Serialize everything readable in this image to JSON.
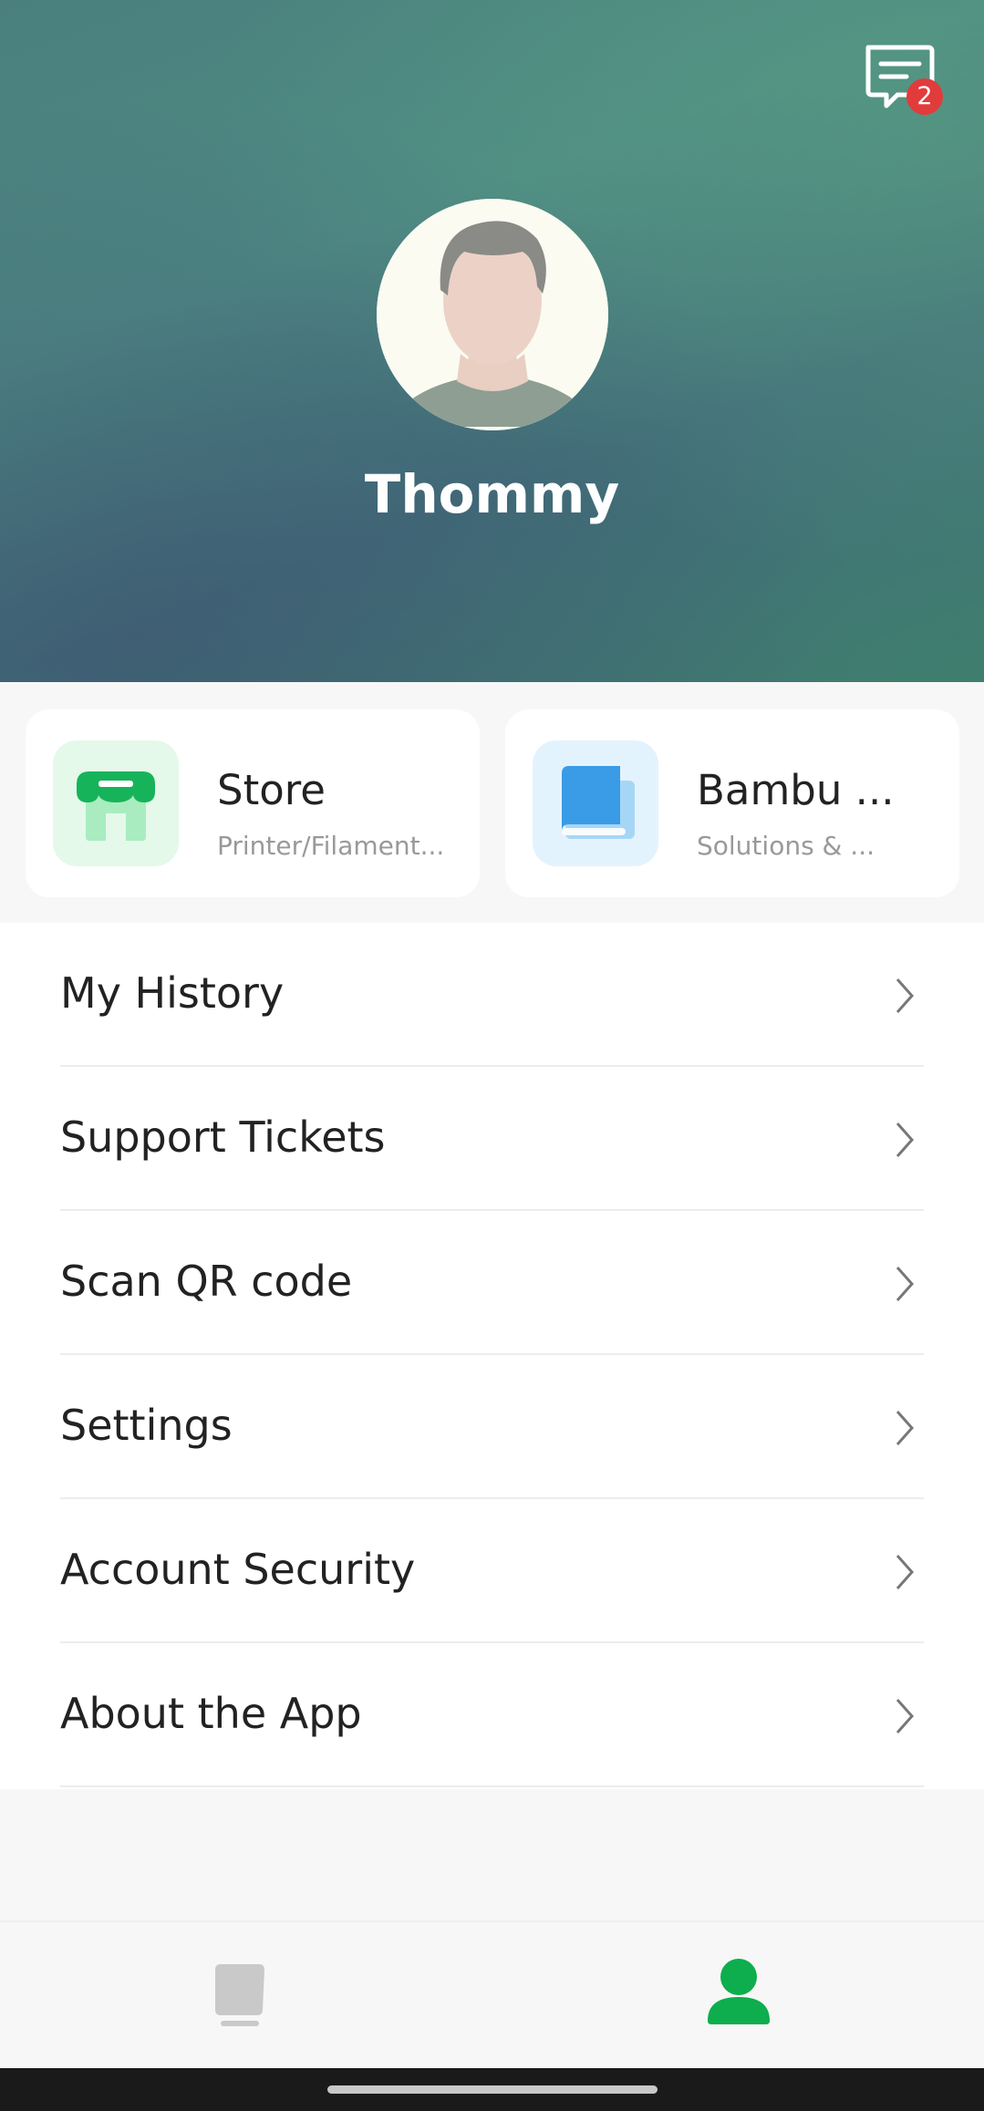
{
  "header": {
    "message_badge_count": "2",
    "username": "Thommy"
  },
  "cards": [
    {
      "title": "Store",
      "subtitle": "Printer/Filament...",
      "icon": "store-icon",
      "accent": "#17b35a"
    },
    {
      "title": "Bambu ...",
      "subtitle": "Solutions & ...",
      "icon": "book-icon",
      "accent": "#3a9be6"
    }
  ],
  "menu": {
    "items": [
      {
        "label": "My History"
      },
      {
        "label": "Support Tickets"
      },
      {
        "label": "Scan QR code"
      },
      {
        "label": "Settings"
      },
      {
        "label": "Account Security"
      },
      {
        "label": "About the App"
      }
    ]
  },
  "tabbar": {
    "tabs": [
      {
        "icon": "printer-device-icon",
        "active": false
      },
      {
        "icon": "person-icon",
        "active": true
      }
    ],
    "active_color": "#0ead4d",
    "inactive_color": "#c9c9c9"
  }
}
